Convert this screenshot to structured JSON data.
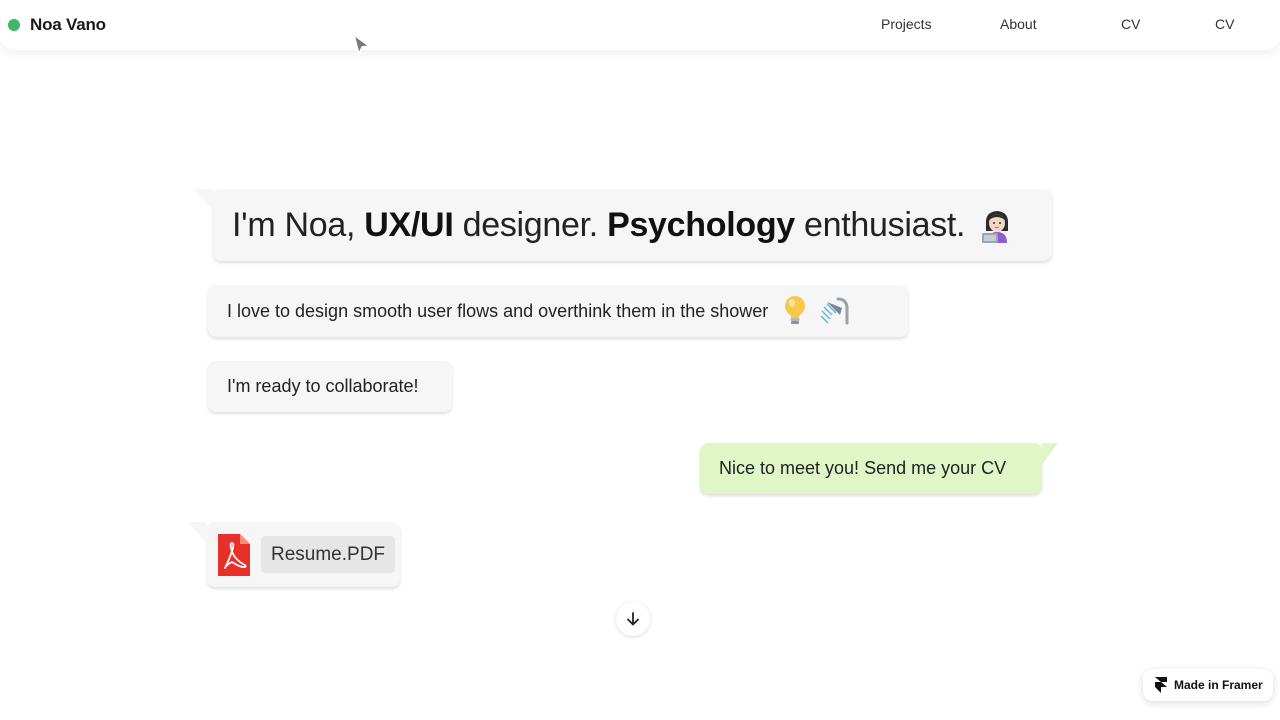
{
  "header": {
    "brand_name": "Noa Vano",
    "status_color": "#3db86b",
    "nav": [
      "Projects",
      "About",
      "CV",
      "CV"
    ]
  },
  "chat": {
    "intro": {
      "part1": "I'm Noa, ",
      "strong1": "UX/UI",
      "part2": " designer. ",
      "strong2": "Psychology",
      "part3": " enthusiast.",
      "emoji": "woman-technologist-icon"
    },
    "message2": {
      "text": "I love to design smooth user flows and overthink them in the shower",
      "emojis": [
        "light-bulb-icon",
        "shower-icon"
      ]
    },
    "message3": {
      "text": "I'm ready to collaborate!"
    },
    "reply": {
      "text": "Nice to meet you! Send me your CV",
      "bubble_color": "#dff7c7"
    },
    "attachment": {
      "icon": "pdf-icon",
      "file_name": "Resume.PDF",
      "icon_color": "#e8302a"
    }
  },
  "scroll_button": {
    "icon": "arrow-down-icon"
  },
  "badge": {
    "label": "Made in Framer",
    "icon": "framer-logo-icon"
  }
}
